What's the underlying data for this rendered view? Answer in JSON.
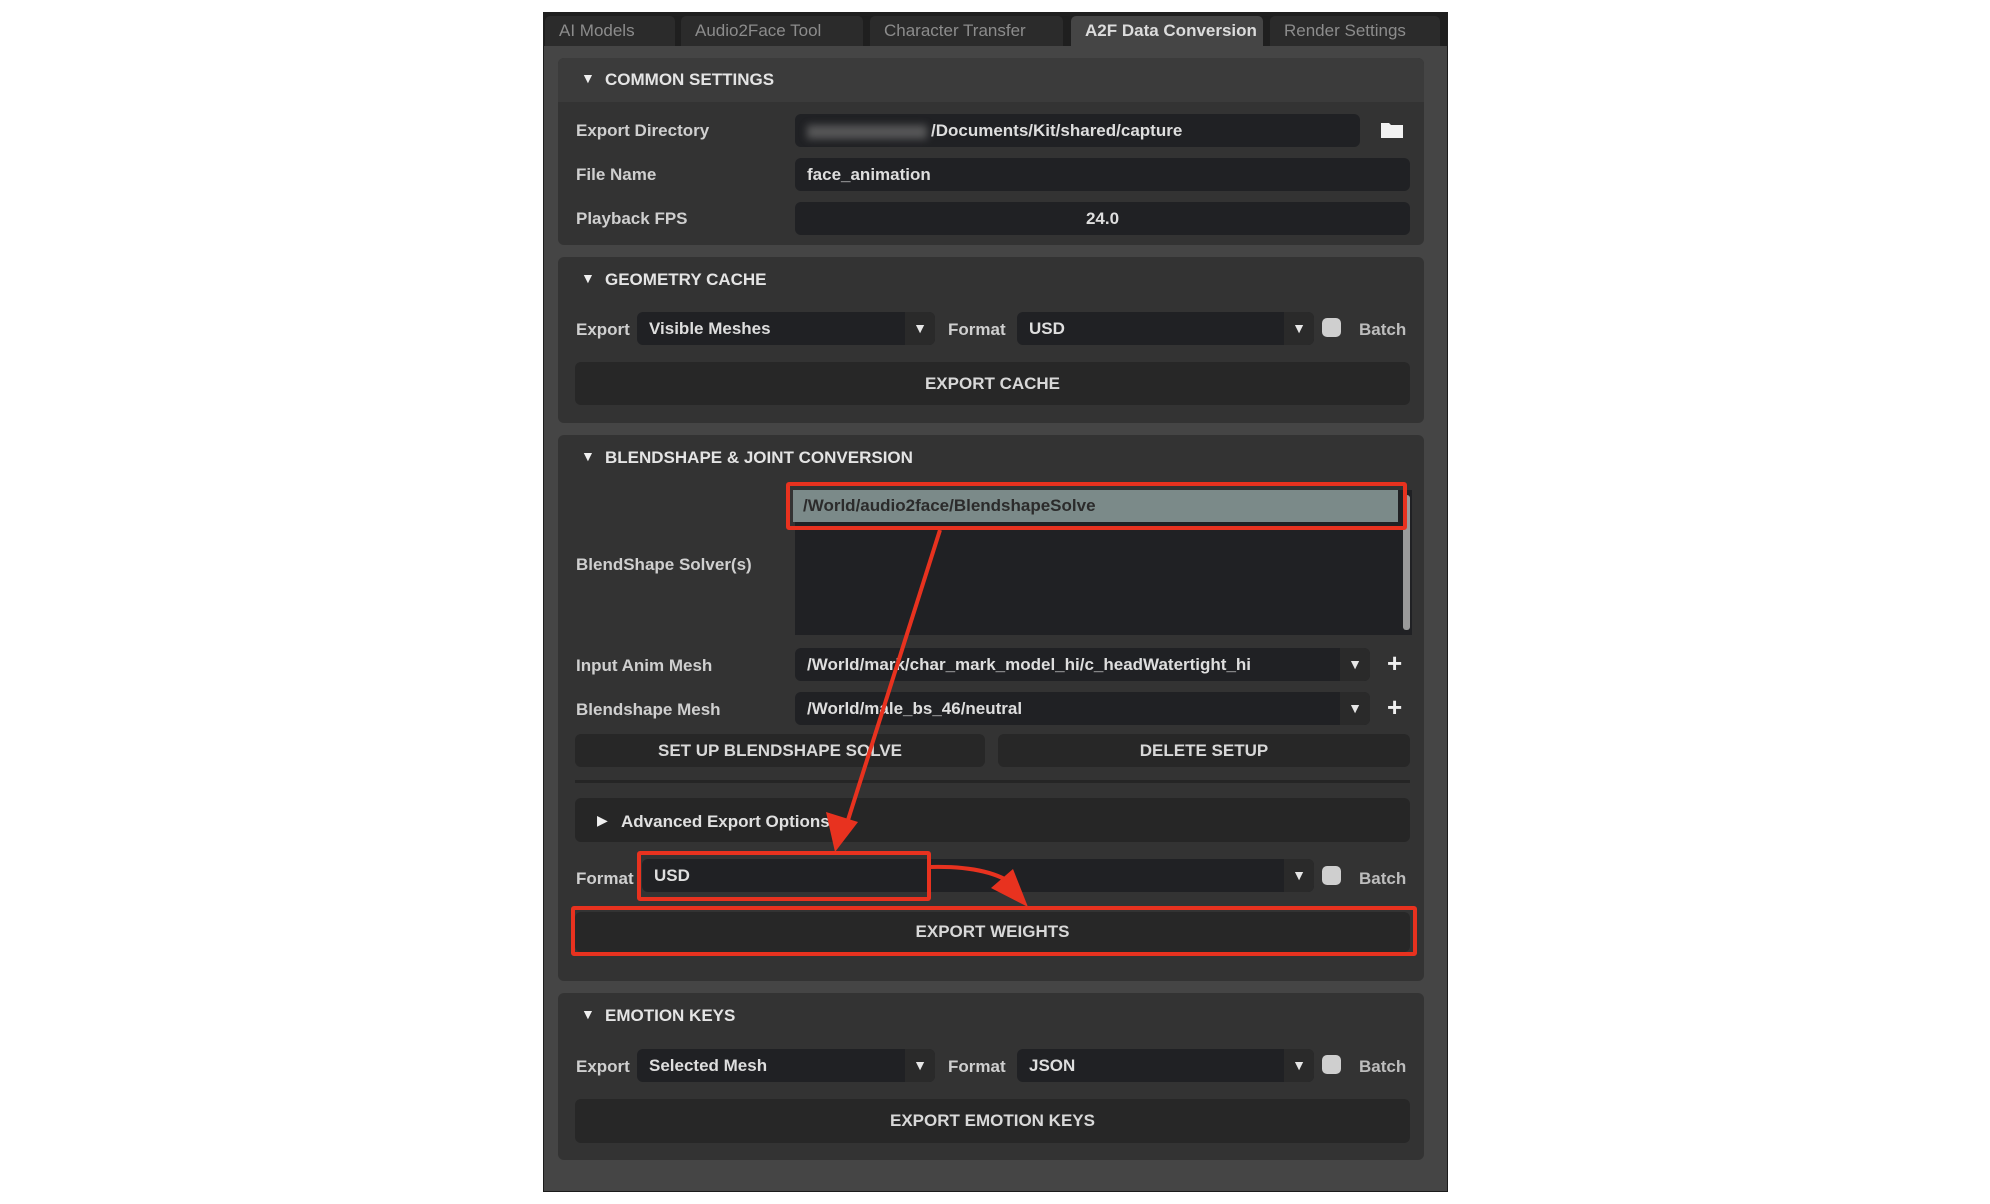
{
  "tabs": [
    {
      "label": "AI Models",
      "active": false
    },
    {
      "label": "Audio2Face Tool",
      "active": false
    },
    {
      "label": "Character Transfer",
      "active": false
    },
    {
      "label": "A2F Data Conversion",
      "active": true
    },
    {
      "label": "Render Settings",
      "active": false
    }
  ],
  "common_settings": {
    "title": "COMMON SETTINGS",
    "export_directory": {
      "label": "Export Directory",
      "value": "/Documents/Kit/shared/capture",
      "prefix_redacted": true
    },
    "file_name": {
      "label": "File Name",
      "value": "face_animation"
    },
    "playback_fps": {
      "label": "Playback FPS",
      "value": "24.0"
    }
  },
  "geometry_cache": {
    "title": "GEOMETRY CACHE",
    "export_label": "Export",
    "export_value": "Visible Meshes",
    "format_label": "Format",
    "format_value": "USD",
    "batch_label": "Batch",
    "batch_checked": false,
    "button": "EXPORT CACHE"
  },
  "blendshape": {
    "title": "BLENDSHAPE & JOINT CONVERSION",
    "solvers_label": "BlendShape Solver(s)",
    "solvers": [
      "/World/audio2face/BlendshapeSolve"
    ],
    "input_anim_mesh": {
      "label": "Input Anim Mesh",
      "value": "/World/mark/char_mark_model_hi/c_headWatertight_hi"
    },
    "blendshape_mesh": {
      "label": "Blendshape Mesh",
      "value": "/World/male_bs_46/neutral"
    },
    "setup_button": "SET UP BLENDSHAPE SOLVE",
    "delete_button": "DELETE SETUP",
    "advanced_label": "Advanced Export Options",
    "format_label": "Format",
    "format_value": "USD",
    "batch_label": "Batch",
    "batch_checked": false,
    "export_button": "EXPORT WEIGHTS"
  },
  "emotion_keys": {
    "title": "EMOTION KEYS",
    "export_label": "Export",
    "export_value": "Selected Mesh",
    "format_label": "Format",
    "format_value": "JSON",
    "batch_label": "Batch",
    "batch_checked": false,
    "button": "EXPORT EMOTION KEYS"
  },
  "icons": {
    "collapse_open": "▼",
    "collapse_closed": "▶",
    "dropdown": "▼",
    "add": "+",
    "folder": "folder-icon"
  },
  "annotation_color": "#e8321f"
}
